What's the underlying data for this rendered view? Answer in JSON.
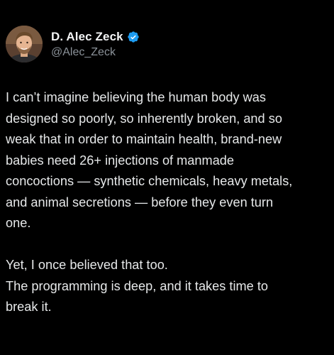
{
  "author": {
    "display_name": "D. Alec Zeck",
    "handle": "@Alec_Zeck",
    "verified_icon": "verified-badge-icon",
    "verified_color": "#1d9bf0"
  },
  "tweet": {
    "paragraph1": [
      "I can’t imagine believing the human body was",
      "designed so poorly, so inherently broken, and so",
      "weak that in order to maintain health, brand-new",
      "babies need 26+ injections of manmade",
      "concoctions — synthetic chemicals, heavy metals,",
      "and animal secretions — before they even turn",
      "one."
    ],
    "paragraph2": [
      "Yet, I once believed that too.",
      "The programming is deep, and it takes time to",
      "break it."
    ]
  },
  "colors": {
    "background": "#000000",
    "text": "#e7e9ea",
    "secondary_text": "#8b9299"
  }
}
